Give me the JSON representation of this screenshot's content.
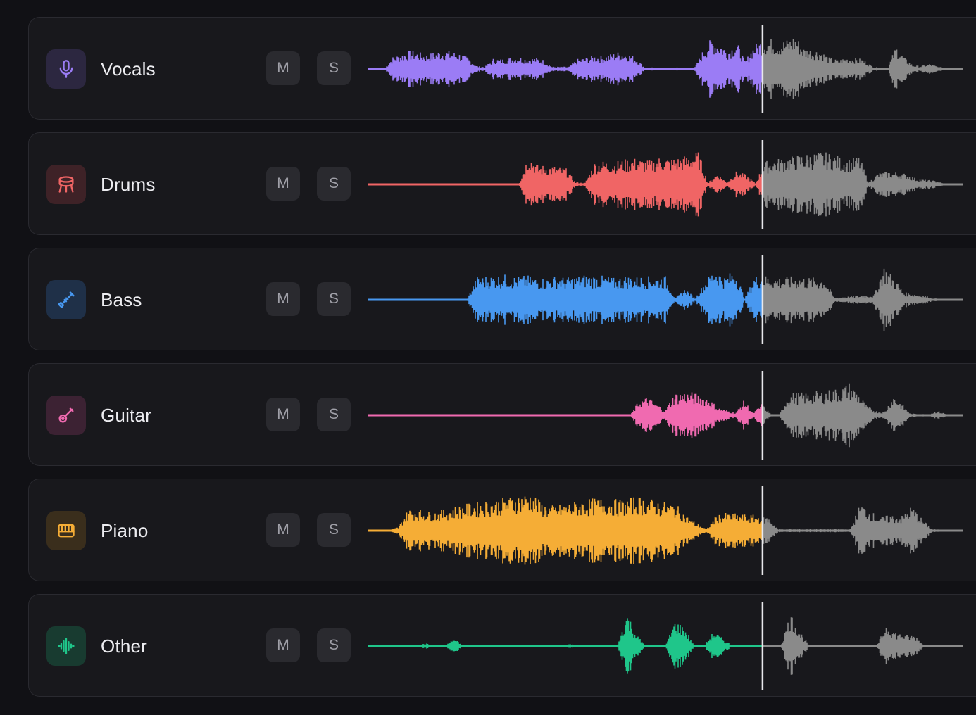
{
  "tracks": [
    {
      "name": "Vocals",
      "icon": "microphone-icon",
      "color": "#9b7cf5",
      "icon_bg": "#2c2740",
      "mute_label": "M",
      "solo_label": "S",
      "playhead": 0.663,
      "amplitude": [
        0,
        0,
        0,
        0.32,
        0.4,
        0.48,
        0.45,
        0.38,
        0.44,
        0.5,
        0.46,
        0.42,
        0.3,
        0.08,
        0.06,
        0.28,
        0.26,
        0.3,
        0.34,
        0.28,
        0.3,
        0.24,
        0.06,
        0.06,
        0.06,
        0.26,
        0.3,
        0.36,
        0.34,
        0.4,
        0.46,
        0.42,
        0.3,
        0.04,
        0.04,
        0.03,
        0.03,
        0.04,
        0.04,
        0.04,
        0.5,
        0.82,
        0.7,
        0.52,
        0.72,
        0.2,
        0.62,
        0.78,
        0.8,
        0.74,
        0.78,
        0.9,
        0.56,
        0.52,
        0.5,
        0.3,
        0.24,
        0.3,
        0.3,
        0.26,
        0.1,
        0.02,
        0.04,
        0.62,
        0.3,
        0.1,
        0.08,
        0.14,
        0.06,
        0.03,
        0,
        0
      ]
    },
    {
      "name": "Drums",
      "icon": "drum-icon",
      "color": "#f06565",
      "icon_bg": "#3e2227",
      "mute_label": "M",
      "solo_label": "S",
      "playhead": 0.663,
      "amplitude": [
        0,
        0,
        0,
        0,
        0,
        0,
        0,
        0,
        0,
        0,
        0,
        0,
        0,
        0,
        0,
        0,
        0,
        0.8,
        0.5,
        0.5,
        0.46,
        0.42,
        0.06,
        0.04,
        0.58,
        0.62,
        0.6,
        0.64,
        0.7,
        0.66,
        0.62,
        0.74,
        0.68,
        0.72,
        0.78,
        0.86,
        0.04,
        0.3,
        0.06,
        0.34,
        0.26,
        0.04,
        0.6,
        0.66,
        0.7,
        0.74,
        0.8,
        0.82,
        0.86,
        0.8,
        0.72,
        0.66,
        0.74,
        0.06,
        0.3,
        0.34,
        0.32,
        0.28,
        0.16,
        0.12,
        0.1,
        0.02,
        0,
        0
      ]
    },
    {
      "name": "Bass",
      "icon": "bass-guitar-icon",
      "color": "#4898f0",
      "icon_bg": "#1f3048",
      "mute_label": "M",
      "solo_label": "S",
      "playhead": 0.663,
      "amplitude": [
        0,
        0,
        0,
        0,
        0,
        0,
        0,
        0,
        0,
        0,
        0,
        0.6,
        0.62,
        0.64,
        0.66,
        0.6,
        0.64,
        0.58,
        0.56,
        0.62,
        0.58,
        0.62,
        0.66,
        0.64,
        0.62,
        0.56,
        0.64,
        0.6,
        0.62,
        0.6,
        0.62,
        0.04,
        0.3,
        0.04,
        0.5,
        0.84,
        0.6,
        0.8,
        0.04,
        0.62,
        0.64,
        0.6,
        0.58,
        0.62,
        0.6,
        0.58,
        0.58,
        0.06,
        0.08,
        0.1,
        0.12,
        0.12,
        0.9,
        0.6,
        0.2,
        0.16,
        0.12,
        0.04,
        0.02,
        0,
        0
      ]
    },
    {
      "name": "Guitar",
      "icon": "guitar-icon",
      "color": "#f06ab0",
      "icon_bg": "#3c2233",
      "mute_label": "M",
      "solo_label": "S",
      "playhead": 0.663,
      "amplitude": [
        0,
        0,
        0,
        0,
        0,
        0,
        0,
        0,
        0,
        0,
        0,
        0,
        0,
        0,
        0,
        0,
        0,
        0,
        0,
        0,
        0,
        0,
        0,
        0,
        0,
        0,
        0,
        0,
        0,
        0,
        0,
        0.4,
        0.48,
        0.3,
        0.14,
        0.58,
        0.62,
        0.6,
        0.54,
        0.44,
        0.2,
        0.14,
        0.06,
        0.4,
        0.06,
        0.3,
        0.04,
        0,
        0.56,
        0.6,
        0.58,
        0.62,
        0.64,
        0.68,
        0.72,
        0.86,
        0.6,
        0.24,
        0.12,
        0.08,
        0.54,
        0.3,
        0.04,
        0.04,
        0.02,
        0.12,
        0.04,
        0,
        0
      ]
    },
    {
      "name": "Piano",
      "icon": "piano-icon",
      "color": "#f5ad36",
      "icon_bg": "#3a2e1c",
      "mute_label": "M",
      "solo_label": "S",
      "playhead": 0.663,
      "amplitude": [
        0,
        0,
        0,
        0.1,
        0.58,
        0.56,
        0.5,
        0.52,
        0.6,
        0.66,
        0.72,
        0.76,
        0.8,
        0.84,
        0.9,
        0.96,
        1,
        0.72,
        0.66,
        0.7,
        0.76,
        0.8,
        0.84,
        0.86,
        0.82,
        0.8,
        0.9,
        0.86,
        0.8,
        0.74,
        0.7,
        0.4,
        0.2,
        0.04,
        0.42,
        0.46,
        0.44,
        0.42,
        0.4,
        0.36,
        0.04,
        0.04,
        0.04,
        0.04,
        0.04,
        0.04,
        0.04,
        0.04,
        0.74,
        0.5,
        0.36,
        0.42,
        0.38,
        0.66,
        0.3,
        0.04,
        0.02,
        0,
        0
      ]
    },
    {
      "name": "Other",
      "icon": "waveform-icon",
      "color": "#1fc68a",
      "icon_bg": "#183b30",
      "mute_label": "M",
      "solo_label": "S",
      "playhead": 0.663,
      "amplitude": [
        0,
        0,
        0,
        0,
        0,
        0,
        0.08,
        0,
        0,
        0.2,
        0,
        0,
        0,
        0,
        0,
        0,
        0,
        0,
        0,
        0,
        0,
        0.06,
        0,
        0,
        0,
        0,
        0,
        0.9,
        0.3,
        0,
        0,
        0,
        0.68,
        0.5,
        0,
        0,
        0.38,
        0.2,
        0,
        0,
        0,
        0,
        0,
        0,
        0.88,
        0.4,
        0,
        0,
        0,
        0,
        0,
        0,
        0,
        0,
        0.6,
        0.36,
        0.3,
        0.28,
        0,
        0,
        0,
        0,
        0
      ]
    }
  ],
  "inactive_color": "#8a8a8a",
  "playhead_color": "#e8e8ec"
}
